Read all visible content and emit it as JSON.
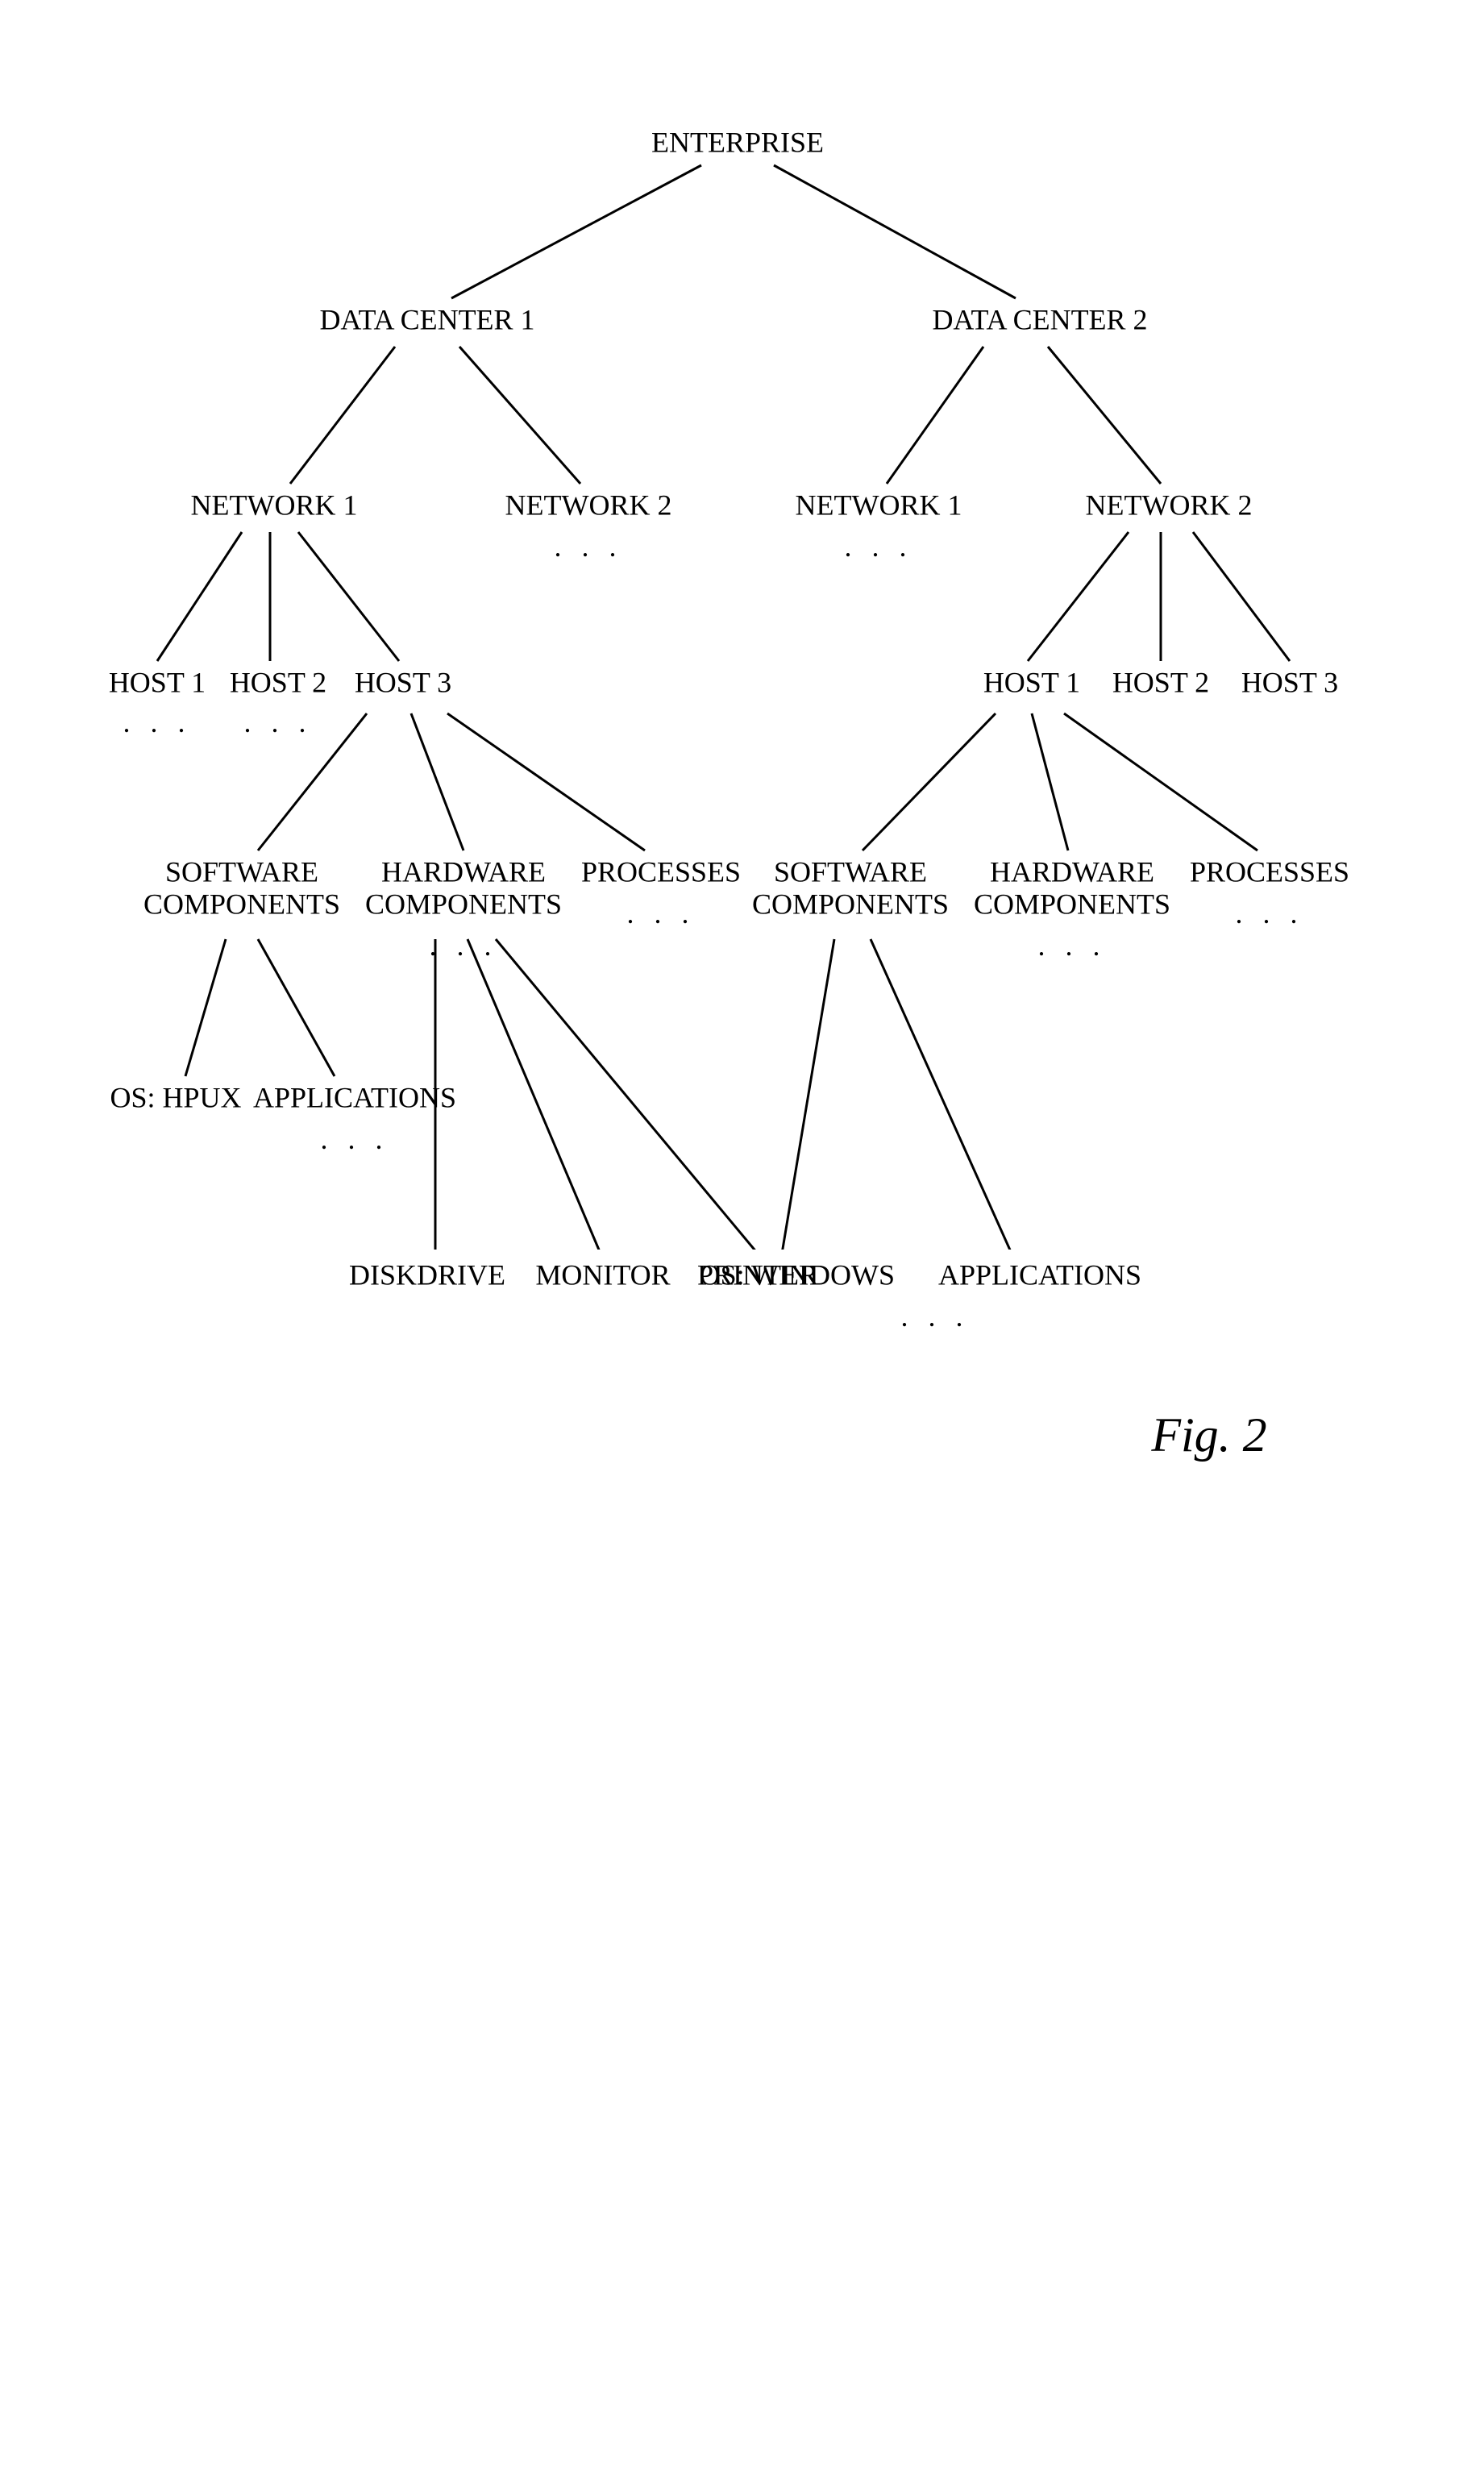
{
  "figure_label": "Fig. 2",
  "nodes": {
    "root": "ENTERPRISE",
    "dc1": "DATA CENTER 1",
    "dc2": "DATA CENTER 2",
    "n1a": "NETWORK 1",
    "n2a": "NETWORK 2",
    "n1b": "NETWORK 1",
    "n2b": "NETWORK 2",
    "h1a": "HOST 1",
    "h2a": "HOST 2",
    "h3a": "HOST 3",
    "h1b": "HOST 1",
    "h2b": "HOST 2",
    "h3b": "HOST 3",
    "sw_a_l1": "SOFTWARE",
    "sw_a_l2": "COMPONENTS",
    "hw_a_l1": "HARDWARE",
    "hw_a_l2": "COMPONENTS",
    "proc_a": "PROCESSES",
    "sw_b_l1": "SOFTWARE",
    "sw_b_l2": "COMPONENTS",
    "hw_b_l1": "HARDWARE",
    "hw_b_l2": "COMPONENTS",
    "proc_b": "PROCESSES",
    "os_a": "OS: HPUX",
    "apps_a": "APPLICATIONS",
    "disk": "DISKDRIVE",
    "mon": "MONITOR",
    "prn": "PRINTER",
    "os_b": "OS: WINDOWS",
    "apps_b": "APPLICATIONS",
    "ellipsis": ". . ."
  }
}
